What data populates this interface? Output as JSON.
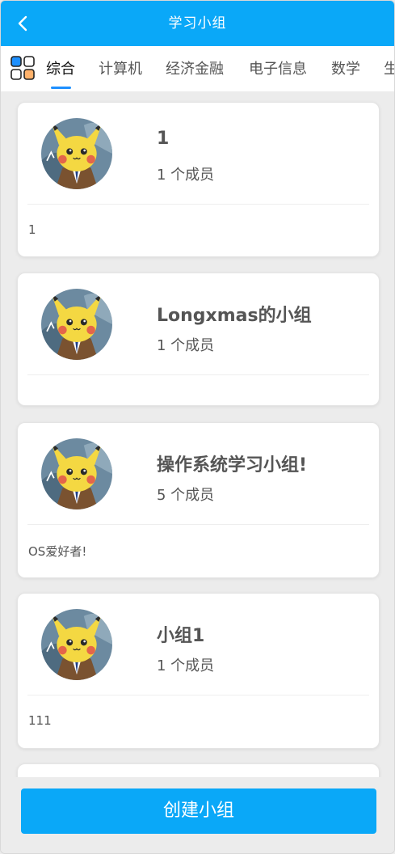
{
  "header": {
    "title": "学习小组",
    "back_icon": "chevron-left-icon"
  },
  "tabs": {
    "menu_icon": "category-grid-icon",
    "items": [
      {
        "label": "综合",
        "active": true
      },
      {
        "label": "计算机"
      },
      {
        "label": "经济金融"
      },
      {
        "label": "电子信息"
      },
      {
        "label": "数学"
      },
      {
        "label": "生"
      }
    ]
  },
  "groups": [
    {
      "name": "1",
      "members": "1 个成员",
      "description": "1"
    },
    {
      "name": "Longxmas的小组",
      "members": "1 个成员",
      "description": ""
    },
    {
      "name": "操作系统学习小组!",
      "members": "5 个成员",
      "description": "OS爱好者!"
    },
    {
      "name": "小组1",
      "members": "1 个成员",
      "description": "111"
    }
  ],
  "footer": {
    "create_label": "创建小组"
  },
  "colors": {
    "primary": "#0aa8f8",
    "background": "#ececec",
    "tab_indicator": "#1e90ff"
  }
}
